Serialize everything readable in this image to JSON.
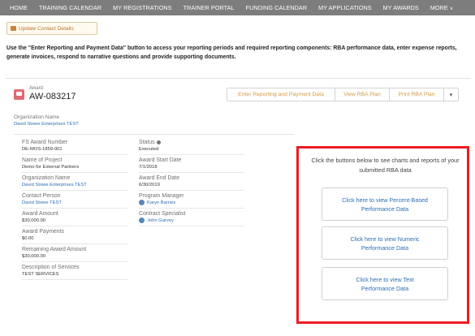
{
  "nav": {
    "items": [
      "HOME",
      "TRAINING CALENDAR",
      "MY REGISTRATIONS",
      "TRAINER PORTAL",
      "FUNDING CALENDAR",
      "MY APPLICATIONS",
      "MY AWARDS"
    ],
    "more_label": "MORE",
    "more_caret": "∨"
  },
  "update_contact": {
    "label": "Update Contact Details",
    "icon": "contact-card-icon"
  },
  "instructions": "Use the \"Enter Reporting and Payment Data\" button to access your reporting periods and required reporting components: RBA performance data, enter expense reports, generate invoices, respond to narrative questions and provide supporting documents.",
  "award": {
    "type_label": "Award",
    "number": "AW-083217",
    "icon": "award-icon",
    "buttons": {
      "enter_reporting": "Enter Reporting and Payment Data",
      "view_rba": "View RBA Plan",
      "print_rba": "Print RBA Plan",
      "dropdown": "▾"
    }
  },
  "organization": {
    "label": "Organization Name",
    "value": "David Stowe Enterprises TEST"
  },
  "details_left": [
    {
      "label": "FS Award Number",
      "value": "DE-MOS-1859-001",
      "link": false
    },
    {
      "label": "Name of Project",
      "value": "Demo for External Partners",
      "link": false
    },
    {
      "label": "Organization Name",
      "value": "David Stowe Enterprises TEST",
      "link": true
    },
    {
      "label": "Contact Person",
      "value": "David Stowe TEST",
      "link": true
    },
    {
      "label": "Award Amount",
      "value": "$30,000.00",
      "link": false
    },
    {
      "label": "Award Payments",
      "value": "$0.00",
      "link": false
    },
    {
      "label": "Remaining Award Amount",
      "value": "$30,000.00",
      "link": false
    },
    {
      "label": "Description of Services",
      "value": "TEST SERVICES",
      "link": false
    }
  ],
  "details_mid": [
    {
      "label": "Status",
      "value": "Executed",
      "link": false
    },
    {
      "label": "Award Start Date",
      "value": "7/1/2018",
      "link": false
    },
    {
      "label": "Award End Date",
      "value": "6/30/2019",
      "link": false
    },
    {
      "label": "Program Manager",
      "value": "Karyn Barnes",
      "link": true
    },
    {
      "label": "Contract Specialist",
      "value": "John Garvey",
      "link": true
    }
  ],
  "status_info_icon": "info-icon",
  "rba_panel": {
    "description": "Click the buttons below to see charts and reports of your submitted RBA data",
    "buttons": [
      "Click here to view Percent-Based Performance Data",
      "Click here to view Numeric Performance Data",
      "Click here to view Text Performance Data"
    ]
  },
  "colors": {
    "nav_bg": "#7d7d7d",
    "highlight_border": "#ec1c24",
    "link": "#2a6db5",
    "accent_orange": "#d39a45",
    "award_icon": "#e06a72"
  }
}
